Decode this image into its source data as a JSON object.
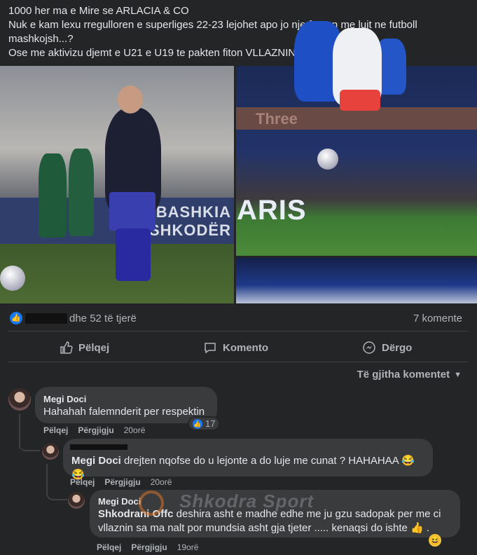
{
  "post": {
    "line1": "1000 her ma e Mire se ARLACIA & CO",
    "line2": "Nuk e kam lexu rregulloren e superliges 22-23 lejohet apo jo  nje femen me lujt ne futboll mashkojsh...?",
    "line3": "Ose me aktivizu djemt e U21 e U19 te pakten fiton VLLAZNIN 100% SHKODRAN",
    "pen_icon": "pen-icon"
  },
  "photos": {
    "photo1_banner": "BASHKIA\nSHKODËR",
    "photo2_board": "Three",
    "photo3_text": "ARIS"
  },
  "reactions": {
    "likes_suffix": "dhe 52 të tjerë",
    "comments_count": "7 komente"
  },
  "actions": {
    "like_label": "Pëlqej",
    "comment_label": "Komento",
    "share_label": "Dërgo"
  },
  "sort": {
    "label": "Të gjitha komentet"
  },
  "comments": [
    {
      "name": "Megi Doci",
      "text": "Hahahah falemnderit per respektin .",
      "like": "Pëlqej",
      "reply": "Përgjigju",
      "time": "20orë",
      "reaction_count": "17"
    },
    {
      "mention": "Megi Doci",
      "text": " drejten nqofse do u lejonte a do luje me cunat ? HAHAHAA 😂😂",
      "like": "Pëlqej",
      "reply": "Përgjigju",
      "time": "20orë"
    },
    {
      "name": "Megi Doci",
      "mention": "Shkodrani Offc",
      "text": " deshira asht e madhe edhe me ju gzu sadopak per me ci vllaznin sa ma nalt por mundsia asht gja tjeter ..... kenaqsi do ishte 👍 .",
      "like": "Pëlqej",
      "reply": "Përgjigju",
      "time": "19orë"
    }
  ],
  "watermark": "Shkodra Sport"
}
